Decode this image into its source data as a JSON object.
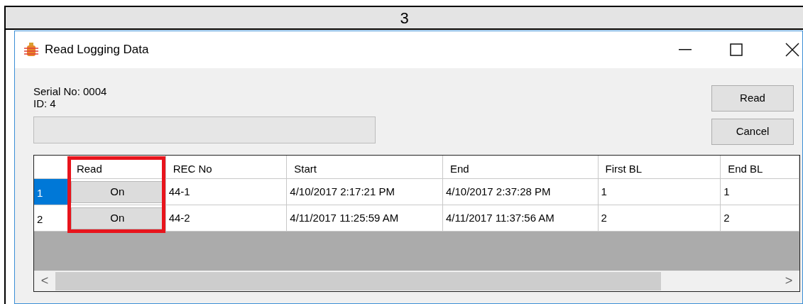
{
  "page_header": "3",
  "window": {
    "title": "Read Logging Data"
  },
  "serial_label": "Serial No: 0004",
  "id_label": "ID: 4",
  "progress": {
    "level": 0
  },
  "buttons": [
    "Read",
    "Cancel"
  ],
  "table": {
    "columns": [
      "Read",
      "REC No",
      "Start",
      "End",
      "First BL",
      "End BL"
    ],
    "rows": [
      {
        "index": "1",
        "selected": true,
        "cells": [
          "On",
          "44-1",
          "4/10/2017 2:17:21 PM",
          "4/10/2017 2:37:28 PM",
          "1",
          "1"
        ]
      },
      {
        "index": "2",
        "selected": false,
        "cells": [
          "On",
          "44-2",
          "4/11/2017 11:25:59 AM",
          "4/11/2017 11:37:56 AM",
          "2",
          "2"
        ]
      }
    ]
  },
  "scroll_left": "<",
  "scroll_right": ">"
}
